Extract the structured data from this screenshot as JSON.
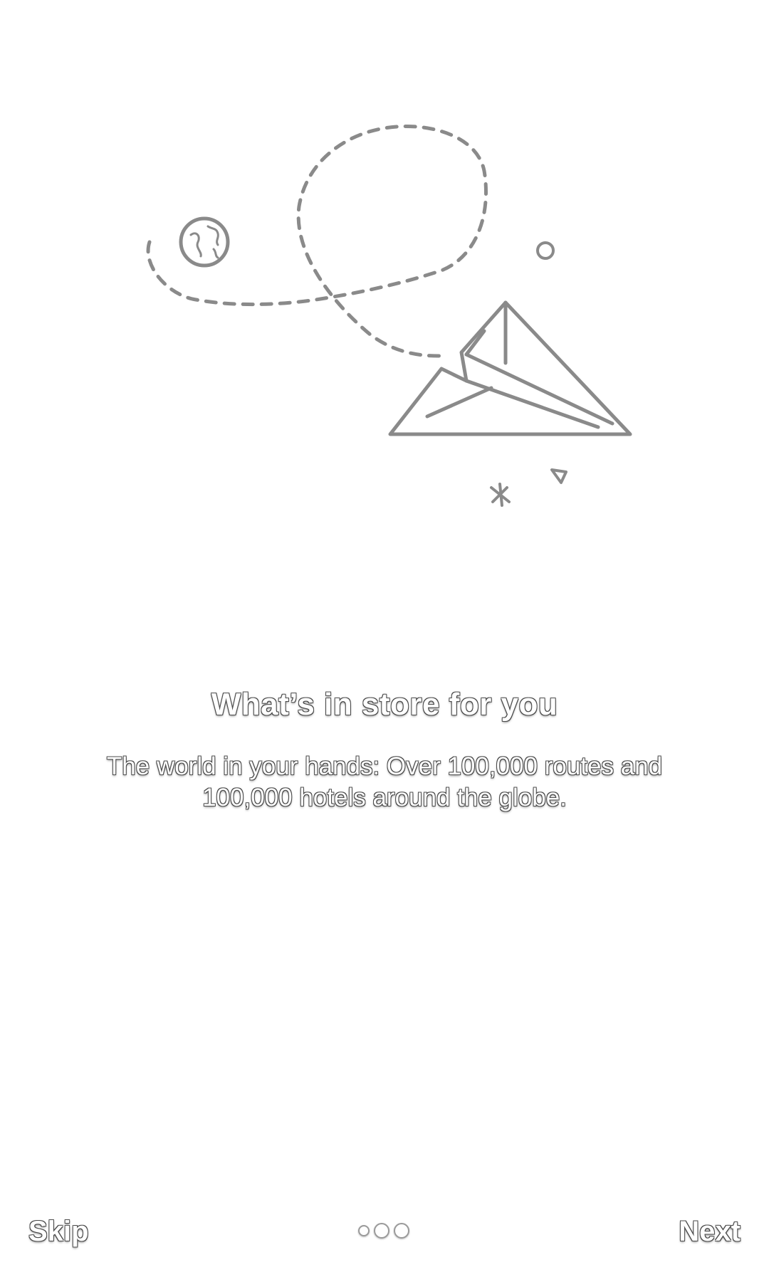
{
  "onboarding": {
    "title": "What’s in store for you",
    "description": "The world in your hands: Over 100,000 routes and 100,000 hotels around the globe.",
    "illustration_icons": [
      "globe-icon",
      "paper-plane-icon",
      "dashed-flight-path",
      "sparkle-icon",
      "small-circle-icon",
      "small-triangle-icon"
    ]
  },
  "navigation": {
    "skip_label": "Skip",
    "next_label": "Next",
    "page_indicator": {
      "total": 3,
      "current": 1
    }
  }
}
